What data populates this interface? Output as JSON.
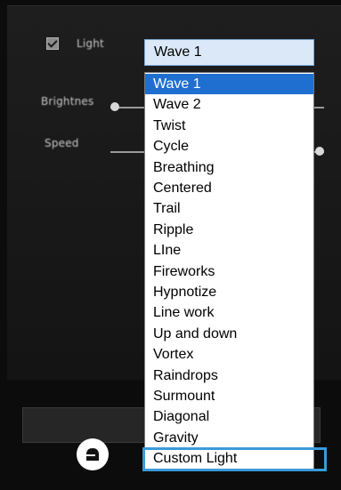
{
  "settings": {
    "light_label": "Light",
    "light_checked": true,
    "brightness_label": "Brightnes",
    "speed_label": "Speed",
    "brightness_level": 0.02,
    "speed_level": 0.98
  },
  "select": {
    "selected": "Wave 1",
    "options": [
      "Wave 1",
      "Wave 2",
      "Twist",
      "Cycle",
      "Breathing",
      "Centered",
      "Trail",
      "Ripple",
      "LIne",
      "Fireworks",
      "Hypnotize",
      "Line work",
      "Up and down",
      "Vortex",
      "Raindrops",
      "Surmount",
      "Diagonal",
      "Gravity",
      "Custom Light"
    ],
    "highlighted_option": "Wave 1",
    "annotated_option": "Custom Light"
  },
  "colors": {
    "selection": "#1f6fd1",
    "annotation_box": "#3b9ad9",
    "select_background": "#dbe8f7"
  },
  "icons": {
    "logo": "brand-logo-icon",
    "checkbox": "checkmark-icon"
  }
}
